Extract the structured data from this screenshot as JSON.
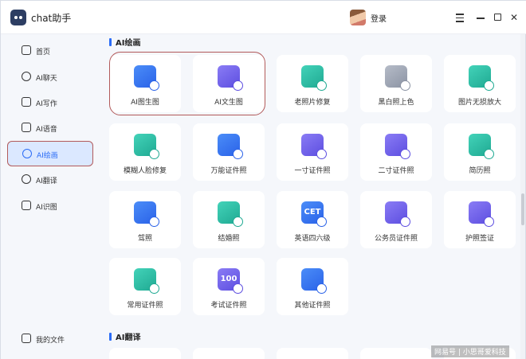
{
  "app": {
    "title": "chat助手",
    "login": "登录"
  },
  "sidebar": {
    "items": [
      {
        "label": "首页"
      },
      {
        "label": "AI聊天"
      },
      {
        "label": "AI写作"
      },
      {
        "label": "AI语音"
      },
      {
        "label": "AI绘画",
        "active": true
      },
      {
        "label": "AI翻译"
      },
      {
        "label": "AI识图"
      }
    ],
    "footer": {
      "label": "我的文件"
    }
  },
  "main": {
    "section1": {
      "title": "AI绘画"
    },
    "section2": {
      "title": "AI翻译"
    },
    "cards": [
      {
        "label": "AI图生图",
        "icon": "image-to-image-icon",
        "color": "#2a62e8"
      },
      {
        "label": "AI文生图",
        "icon": "text-to-image-icon",
        "color": "#5d4ee0"
      },
      {
        "label": "老照片修复",
        "icon": "old-photo-repair-icon",
        "color": "#1fa992"
      },
      {
        "label": "黑白照上色",
        "icon": "colorize-icon",
        "color": "#8b93a3"
      },
      {
        "label": "图片无损放大",
        "icon": "upscale-icon",
        "color": "#1fa992"
      },
      {
        "label": "模糊人脸修复",
        "icon": "face-repair-icon",
        "color": "#1fa992"
      },
      {
        "label": "万能证件照",
        "icon": "universal-id-photo-icon",
        "color": "#2a62e8"
      },
      {
        "label": "一寸证件照",
        "icon": "one-inch-photo-icon",
        "color": "#5d4ee0"
      },
      {
        "label": "二寸证件照",
        "icon": "two-inch-photo-icon",
        "color": "#5d4ee0"
      },
      {
        "label": "简历照",
        "icon": "resume-photo-icon",
        "color": "#1fa992"
      },
      {
        "label": "驾照",
        "icon": "driver-license-icon",
        "color": "#2a62e8"
      },
      {
        "label": "结婚照",
        "icon": "wedding-photo-icon",
        "color": "#1fa992"
      },
      {
        "label": "英语四六级",
        "icon": "cet-icon",
        "glyph": "CET",
        "color": "#2a62e8"
      },
      {
        "label": "公务员证件照",
        "icon": "civil-servant-photo-icon",
        "color": "#5d4ee0"
      },
      {
        "label": "护照签证",
        "icon": "passport-visa-icon",
        "color": "#5d4ee0"
      },
      {
        "label": "常用证件照",
        "icon": "common-id-photo-icon",
        "color": "#1fa992"
      },
      {
        "label": "考试证件照",
        "icon": "exam-photo-icon",
        "glyph": "100",
        "color": "#5d4ee0"
      },
      {
        "label": "其他证件照",
        "icon": "other-photo-icon",
        "color": "#2a62e8"
      }
    ]
  },
  "watermark": "网易号 | 小思哥爱科技"
}
